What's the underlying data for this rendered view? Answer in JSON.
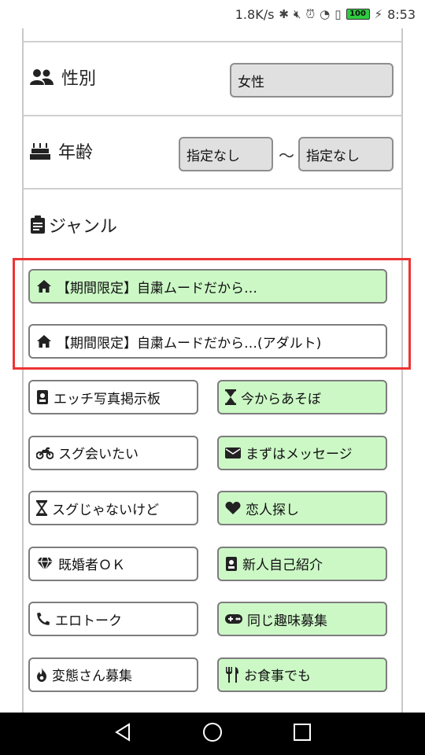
{
  "status_bar": {
    "speed": "1.8K/s",
    "battery": "100",
    "time": "8:53"
  },
  "form": {
    "gender": {
      "label": "性別",
      "value": "女性",
      "icon": "users-icon"
    },
    "age": {
      "label": "年齢",
      "from": "指定なし",
      "separator": "～",
      "to": "指定なし",
      "icon": "cake-icon"
    },
    "genre": {
      "label": "ジャンル",
      "icon": "clipboard-icon"
    }
  },
  "wide_genres": [
    {
      "label": "【期間限定】自粛ムードだから…",
      "icon": "home-icon",
      "selected": true
    },
    {
      "label": "【期間限定】自粛ムードだから…(アダルト)",
      "icon": "home-icon",
      "selected": false
    }
  ],
  "genres": [
    {
      "label": "エッチ写真掲示板",
      "icon": "id-card-icon",
      "selected": false
    },
    {
      "label": "今からあそぼ",
      "icon": "hourglass-icon",
      "selected": true
    },
    {
      "label": "スグ会いたい",
      "icon": "motorcycle-icon",
      "selected": false
    },
    {
      "label": "まずはメッセージ",
      "icon": "envelope-icon",
      "selected": true
    },
    {
      "label": "スグじゃないけど",
      "icon": "hourglass-outline-icon",
      "selected": false
    },
    {
      "label": "恋人探し",
      "icon": "heart-icon",
      "selected": true
    },
    {
      "label": "既婚者ＯＫ",
      "icon": "diamond-icon",
      "selected": false
    },
    {
      "label": "新人自己紹介",
      "icon": "id-card-icon",
      "selected": true
    },
    {
      "label": "エロトーク",
      "icon": "phone-icon",
      "selected": false
    },
    {
      "label": "同じ趣味募集",
      "icon": "gamepad-icon",
      "selected": true
    },
    {
      "label": "変態さん募集",
      "icon": "fire-icon",
      "selected": false
    },
    {
      "label": "お食事でも",
      "icon": "utensils-icon",
      "selected": true
    }
  ],
  "colors": {
    "selected_bg": "#ccf8c6",
    "highlight": "#ee3333"
  }
}
